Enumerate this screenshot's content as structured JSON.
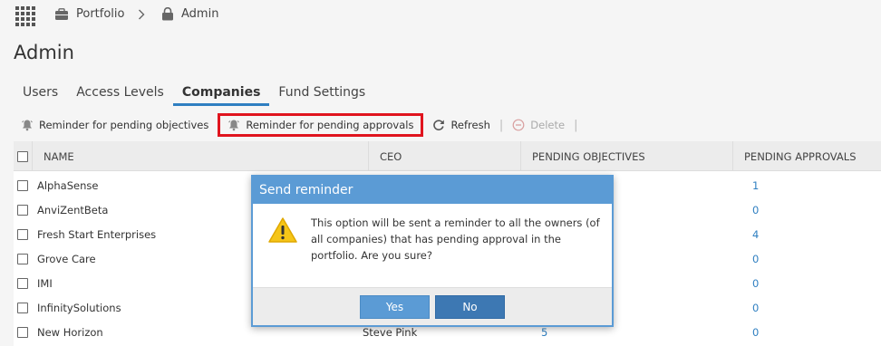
{
  "breadcrumb": {
    "portfolio": "Portfolio",
    "admin": "Admin"
  },
  "page_title": "Admin",
  "tabs": [
    {
      "label": "Users",
      "active": false
    },
    {
      "label": "Access Levels",
      "active": false
    },
    {
      "label": "Companies",
      "active": true
    },
    {
      "label": "Fund Settings",
      "active": false
    }
  ],
  "toolbar": {
    "reminder_objectives": "Reminder for pending objectives",
    "reminder_approvals": "Reminder for pending approvals",
    "refresh": "Refresh",
    "delete": "Delete"
  },
  "table": {
    "columns": [
      "NAME",
      "CEO",
      "PENDING OBJECTIVES",
      "PENDING APPROVALS"
    ],
    "rows": [
      {
        "name": "AlphaSense",
        "ceo": "",
        "objectives": "",
        "approvals": "1"
      },
      {
        "name": "AnviZentBeta",
        "ceo": "",
        "objectives": "",
        "approvals": "0"
      },
      {
        "name": "Fresh Start Enterprises",
        "ceo": "",
        "objectives": "",
        "approvals": "4"
      },
      {
        "name": "Grove Care",
        "ceo": "",
        "objectives": "",
        "approvals": "0"
      },
      {
        "name": "IMI",
        "ceo": "",
        "objectives": "",
        "approvals": "0"
      },
      {
        "name": "InfinitySolutions",
        "ceo": "",
        "objectives": "",
        "approvals": "0"
      },
      {
        "name": "New Horizon",
        "ceo": "Steve Pink",
        "objectives": "5",
        "approvals": "0"
      }
    ]
  },
  "dialog": {
    "title": "Send reminder",
    "message": "This option will be sent a reminder to all the owners (of all companies) that has pending approval in the portfolio. Are you sure?",
    "yes": "Yes",
    "no": "No"
  },
  "colors": {
    "accent": "#5b9bd5",
    "highlight": "#e0141e",
    "link": "#2f7fc1",
    "warning": "#f5c518"
  }
}
